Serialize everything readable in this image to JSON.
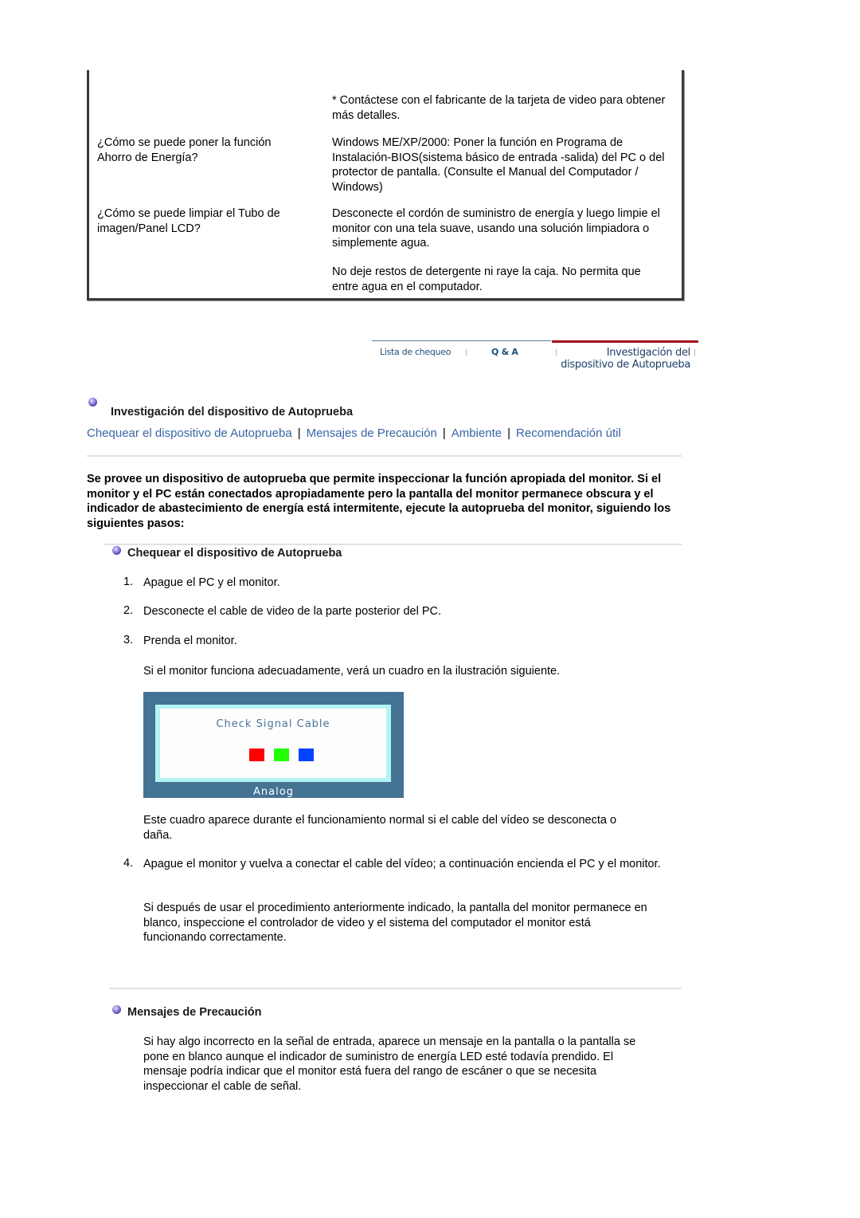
{
  "faq": [
    {
      "question": "",
      "answers": [
        "* Contáctese con el fabricante de la tarjeta de video para obtener más detalles."
      ]
    },
    {
      "question": "¿Cómo se puede poner la función Ahorro de Energía?",
      "answers": [
        "Windows ME/XP/2000: Poner la función en Programa de Instalación-BIOS(sistema básico de entrada -salida) del PC o del protector de pantalla. (Consulte el Manual del Computador / Windows)"
      ]
    },
    {
      "question": "¿Cómo se puede limpiar el Tubo de imagen/Panel LCD?",
      "answers": [
        "Desconecte el cordón de suministro de energía y luego limpie el monitor con una tela suave, usando una solución limpiadora o simplemente agua.",
        "No deje restos de detergente ni raye la caja. No permita que entre agua en el computador."
      ]
    }
  ],
  "tabs": {
    "items": [
      {
        "label": "Lista de chequeo"
      },
      {
        "label": "Q & A"
      }
    ],
    "active": {
      "line1": "Investigación del",
      "line2": "dispositivo de Autoprueba"
    },
    "colors": {
      "active_bar": "#a3121f",
      "inactive_bar": "#4f7fa3"
    }
  },
  "section": {
    "title": "Investigación del dispositivo de Autoprueba",
    "nav_links": [
      {
        "label": "Chequear el dispositivo de Autoprueba"
      },
      {
        "label": "Mensajes de Precaución"
      },
      {
        "label": "Ambiente"
      },
      {
        "label": "Recomendación útil"
      }
    ],
    "separator": "|",
    "intro": "Se provee un dispositivo de autoprueba que permite inspeccionar la función apropiada del monitor. Si el monitor y el PC están conectados apropiadamente pero la pantalla del monitor permanece obscura y el indicador de abastecimiento de energía está intermitente, ejecute la autoprueba del monitor, siguiendo los siguientes pasos:"
  },
  "selftest": {
    "title": "Chequear el dispositivo de Autoprueba",
    "steps": [
      {
        "num": "1.",
        "text": "Apague el PC y el monitor."
      },
      {
        "num": "2.",
        "text": "Desconecte el cable de video de la parte posterior del PC."
      },
      {
        "num": "3.",
        "text": "Prenda el monitor."
      }
    ],
    "step3_note": "Si el monitor funciona adecuadamente, verá un cuadro en la ilustración siguiente.",
    "illustration": {
      "message": "Check Signal Cable",
      "label": "Analog",
      "swatches": [
        "#ff0000",
        "#22ff00",
        "#0044ff"
      ]
    },
    "illustration_caption": "Este cuadro aparece durante el funcionamiento normal si el cable del vídeo se desconecta o daña.",
    "step4": {
      "num": "4.",
      "text": "Apague el monitor y vuelva a conectar el cable del vídeo; a continuación encienda el PC y el monitor."
    },
    "step4_note": "Si después de usar el procedimiento anteriormente indicado, la pantalla del monitor permanece en blanco, inspeccione el controlador de video y el sistema del computador el monitor está funcionando correctamente."
  },
  "warnings": {
    "title": "Mensajes de Precaución",
    "text": "Si hay algo incorrecto en la señal de entrada, aparece un mensaje en la pantalla o la pantalla se pone en blanco aunque el indicador de suministro de energía LED esté todavía prendido. El mensaje podría indicar que el monitor está fuera del rango de escáner o que se necesita inspeccionar el cable de señal."
  }
}
